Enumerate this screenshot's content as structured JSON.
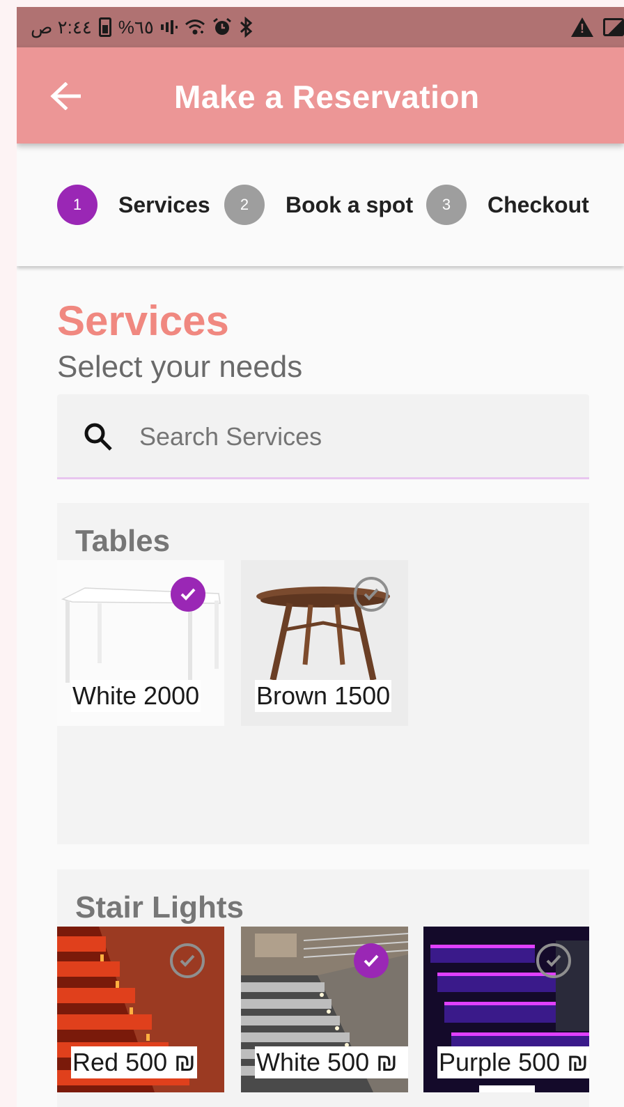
{
  "status_bar": {
    "time": "٢:٤٤ ص",
    "battery": "%٦٥",
    "icons": [
      "battery-icon",
      "signal-icon",
      "wifi-icon",
      "alarm-icon",
      "bluetooth-icon",
      "warning-icon",
      "image-icon"
    ]
  },
  "app_bar": {
    "title": "Make a Reservation",
    "back_icon": "arrow-left-icon"
  },
  "stepper": {
    "steps": [
      {
        "number": "1",
        "label": "Services",
        "state": "active"
      },
      {
        "number": "2",
        "label": "Book a spot",
        "state": "inactive"
      },
      {
        "number": "3",
        "label": "Checkout",
        "state": "inactive"
      }
    ]
  },
  "colors": {
    "status_bar": "#b07272",
    "app_bar": "#ec9696",
    "accent": "#9a27b5",
    "step_inactive": "#9e9e9e",
    "section_title": "#f08880"
  },
  "services": {
    "title": "Services",
    "subtitle": "Select your needs",
    "search": {
      "placeholder": "Search Services",
      "value": ""
    },
    "categories": [
      {
        "title": "Tables",
        "items": [
          {
            "name": "White",
            "price": "2000",
            "selected": true
          },
          {
            "name": "Brown",
            "price": "1500",
            "selected": false
          }
        ]
      },
      {
        "title": "Stair Lights",
        "items": [
          {
            "name": "Red",
            "price": "500 ₪",
            "selected": false
          },
          {
            "name": "White",
            "price": "500 ₪",
            "selected": true
          },
          {
            "name": "Purple",
            "price": "500 ₪",
            "selected": false
          }
        ]
      }
    ]
  }
}
